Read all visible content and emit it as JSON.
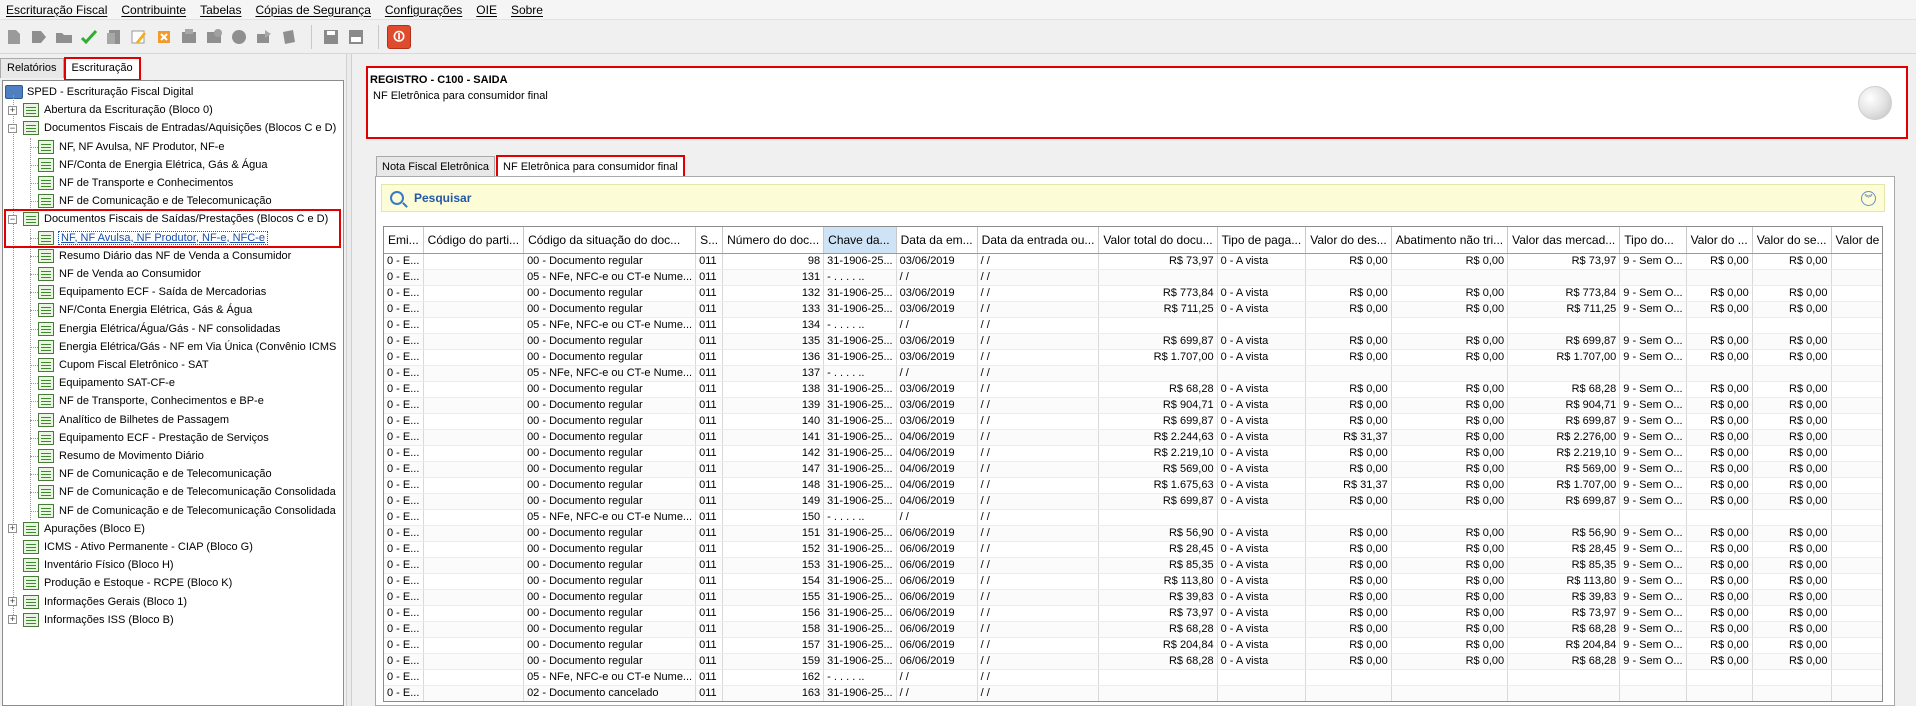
{
  "menu": [
    {
      "label": "Escrituração Fiscal"
    },
    {
      "label": "Contribuinte"
    },
    {
      "label": "Tabelas"
    },
    {
      "label": "Cópias de Segurança"
    },
    {
      "label": "Configurações"
    },
    {
      "label": "OIE"
    },
    {
      "label": "Sobre"
    }
  ],
  "toolbar": {
    "icons": [
      "new-record-icon",
      "forward-icon",
      "open-folder-icon",
      "validate-check-icon",
      "copy-icon",
      "edit-pen-icon",
      "delete-x-icon",
      "import-icon",
      "export-icon",
      "globe-icon",
      "send-icon",
      "print-icon",
      "save-icon",
      "report-icon",
      "stop-icon"
    ],
    "stop_glyph": "⏼"
  },
  "left_tabs": [
    {
      "label": "Relatórios"
    },
    {
      "label": "Escrituração"
    }
  ],
  "tree": {
    "root": "SPED - Escrituração Fiscal Digital",
    "items": [
      {
        "label": "Abertura da Escrituração (Bloco 0)",
        "level": 1,
        "expander": "+"
      },
      {
        "label": "Documentos Fiscais de Entradas/Aquisições (Blocos C e D)",
        "level": 1,
        "expander": "−"
      },
      {
        "label": "NF, NF Avulsa, NF Produtor, NF-e",
        "level": 2
      },
      {
        "label": "NF/Conta de Energia Elétrica, Gás & Água",
        "level": 2
      },
      {
        "label": "NF de Transporte e Conhecimentos",
        "level": 2
      },
      {
        "label": "NF de Comunicação e de Telecomunicação",
        "level": 2
      },
      {
        "label": "Documentos Fiscais de Saídas/Prestações (Blocos C e D)",
        "level": 1,
        "expander": "−"
      },
      {
        "label": "NF, NF Avulsa, NF Produtor, NF-e, NFC-e",
        "level": 2,
        "selected": true
      },
      {
        "label": "Resumo Diário das NF de Venda a Consumidor",
        "level": 2
      },
      {
        "label": "NF de Venda ao Consumidor",
        "level": 2
      },
      {
        "label": "Equipamento ECF - Saída de Mercadorias",
        "level": 2
      },
      {
        "label": "NF/Conta Energia Elétrica, Gás & Água",
        "level": 2
      },
      {
        "label": "Energia Elétrica/Água/Gás - NF consolidadas",
        "level": 2
      },
      {
        "label": "Energia Elétrica/Gás - NF em Via Única (Convênio ICMS",
        "level": 2
      },
      {
        "label": "Cupom Fiscal Eletrônico - SAT",
        "level": 2
      },
      {
        "label": "Equipamento SAT-CF-e",
        "level": 2
      },
      {
        "label": "NF de Transporte, Conhecimentos e BP-e",
        "level": 2
      },
      {
        "label": "Analítico de Bilhetes de Passagem",
        "level": 2
      },
      {
        "label": "Equipamento ECF - Prestação de Serviços",
        "level": 2
      },
      {
        "label": "Resumo de Movimento Diário",
        "level": 2
      },
      {
        "label": "NF de Comunicação e de Telecomunicação",
        "level": 2
      },
      {
        "label": "NF de Comunicação e de Telecomunicação Consolidada",
        "level": 2
      },
      {
        "label": "NF de Comunicação e de Telecomunicação Consolidada",
        "level": 2
      },
      {
        "label": "Apurações (Bloco E)",
        "level": 1,
        "expander": "+"
      },
      {
        "label": "ICMS - Ativo Permanente - CIAP (Bloco G)",
        "level": 1
      },
      {
        "label": "Inventário Físico (Bloco H)",
        "level": 1
      },
      {
        "label": "Produção e Estoque - RCPE (Bloco K)",
        "level": 1
      },
      {
        "label": "Informações Gerais (Bloco 1)",
        "level": 1,
        "expander": "+"
      },
      {
        "label": "Informações ISS (Bloco B)",
        "level": 1,
        "expander": "+"
      }
    ]
  },
  "header": {
    "title": "REGISTRO - C100 - SAIDA",
    "subtitle": "NF Eletrônica para consumidor final"
  },
  "content_tabs": [
    {
      "label": "Nota Fiscal Eletrônica"
    },
    {
      "label": "NF Eletrônica para consumidor final"
    }
  ],
  "search": {
    "label": "Pesquisar",
    "collapse_glyph": "︾"
  },
  "table": {
    "columns": [
      "Emi...",
      "Código do parti...",
      "Código da situação do doc...",
      "S...",
      "Número do doc...",
      "Chave da...",
      "Data da em...",
      "Data da entrada ou...",
      "Valor total do docu...",
      "Tipo de paga...",
      "Valor do des...",
      "Abatimento não tri...",
      "Valor das mercad...",
      "Tipo do...",
      "Valor do ...",
      "Valor do se...",
      "Valor de"
    ],
    "rows": [
      [
        "0 - E...",
        "",
        "00 - Documento regular",
        "011",
        "98",
        "31-1906-25...",
        "03/06/2019",
        " / /",
        "R$ 73,97",
        "0 - A vista",
        "R$ 0,00",
        "R$ 0,00",
        "R$ 73,97",
        "9 - Sem O...",
        "R$ 0,00",
        "R$ 0,00",
        ""
      ],
      [
        "0 - E...",
        "",
        "05 - NFe, NFC-e ou CT-e Nume...",
        "011",
        "131",
        " -  .  .  .  .  ..",
        " / /",
        " / /",
        "",
        "",
        "",
        "",
        "",
        "",
        "",
        "",
        ""
      ],
      [
        "0 - E...",
        "",
        "00 - Documento regular",
        "011",
        "132",
        "31-1906-25...",
        "03/06/2019",
        " / /",
        "R$ 773,84",
        "0 - A vista",
        "R$ 0,00",
        "R$ 0,00",
        "R$ 773,84",
        "9 - Sem O...",
        "R$ 0,00",
        "R$ 0,00",
        ""
      ],
      [
        "0 - E...",
        "",
        "00 - Documento regular",
        "011",
        "133",
        "31-1906-25...",
        "03/06/2019",
        " / /",
        "R$ 711,25",
        "0 - A vista",
        "R$ 0,00",
        "R$ 0,00",
        "R$ 711,25",
        "9 - Sem O...",
        "R$ 0,00",
        "R$ 0,00",
        ""
      ],
      [
        "0 - E...",
        "",
        "05 - NFe, NFC-e ou CT-e Nume...",
        "011",
        "134",
        " -  .  .  .  .  ..",
        " / /",
        " / /",
        "",
        "",
        "",
        "",
        "",
        "",
        "",
        "",
        ""
      ],
      [
        "0 - E...",
        "",
        "00 - Documento regular",
        "011",
        "135",
        "31-1906-25...",
        "03/06/2019",
        " / /",
        "R$ 699,87",
        "0 - A vista",
        "R$ 0,00",
        "R$ 0,00",
        "R$ 699,87",
        "9 - Sem O...",
        "R$ 0,00",
        "R$ 0,00",
        ""
      ],
      [
        "0 - E...",
        "",
        "00 - Documento regular",
        "011",
        "136",
        "31-1906-25...",
        "03/06/2019",
        " / /",
        "R$ 1.707,00",
        "0 - A vista",
        "R$ 0,00",
        "R$ 0,00",
        "R$ 1.707,00",
        "9 - Sem O...",
        "R$ 0,00",
        "R$ 0,00",
        ""
      ],
      [
        "0 - E...",
        "",
        "05 - NFe, NFC-e ou CT-e Nume...",
        "011",
        "137",
        " -  .  .  .  .  ..",
        " / /",
        " / /",
        "",
        "",
        "",
        "",
        "",
        "",
        "",
        "",
        ""
      ],
      [
        "0 - E...",
        "",
        "00 - Documento regular",
        "011",
        "138",
        "31-1906-25...",
        "03/06/2019",
        " / /",
        "R$ 68,28",
        "0 - A vista",
        "R$ 0,00",
        "R$ 0,00",
        "R$ 68,28",
        "9 - Sem O...",
        "R$ 0,00",
        "R$ 0,00",
        ""
      ],
      [
        "0 - E...",
        "",
        "00 - Documento regular",
        "011",
        "139",
        "31-1906-25...",
        "03/06/2019",
        " / /",
        "R$ 904,71",
        "0 - A vista",
        "R$ 0,00",
        "R$ 0,00",
        "R$ 904,71",
        "9 - Sem O...",
        "R$ 0,00",
        "R$ 0,00",
        ""
      ],
      [
        "0 - E...",
        "",
        "00 - Documento regular",
        "011",
        "140",
        "31-1906-25...",
        "03/06/2019",
        " / /",
        "R$ 699,87",
        "0 - A vista",
        "R$ 0,00",
        "R$ 0,00",
        "R$ 699,87",
        "9 - Sem O...",
        "R$ 0,00",
        "R$ 0,00",
        ""
      ],
      [
        "0 - E...",
        "",
        "00 - Documento regular",
        "011",
        "141",
        "31-1906-25...",
        "04/06/2019",
        " / /",
        "R$ 2.244,63",
        "0 - A vista",
        "R$ 31,37",
        "R$ 0,00",
        "R$ 2.276,00",
        "9 - Sem O...",
        "R$ 0,00",
        "R$ 0,00",
        ""
      ],
      [
        "0 - E...",
        "",
        "00 - Documento regular",
        "011",
        "142",
        "31-1906-25...",
        "04/06/2019",
        " / /",
        "R$ 2.219,10",
        "0 - A vista",
        "R$ 0,00",
        "R$ 0,00",
        "R$ 2.219,10",
        "9 - Sem O...",
        "R$ 0,00",
        "R$ 0,00",
        ""
      ],
      [
        "0 - E...",
        "",
        "00 - Documento regular",
        "011",
        "147",
        "31-1906-25...",
        "04/06/2019",
        " / /",
        "R$ 569,00",
        "0 - A vista",
        "R$ 0,00",
        "R$ 0,00",
        "R$ 569,00",
        "9 - Sem O...",
        "R$ 0,00",
        "R$ 0,00",
        ""
      ],
      [
        "0 - E...",
        "",
        "00 - Documento regular",
        "011",
        "148",
        "31-1906-25...",
        "04/06/2019",
        " / /",
        "R$ 1.675,63",
        "0 - A vista",
        "R$ 31,37",
        "R$ 0,00",
        "R$ 1.707,00",
        "9 - Sem O...",
        "R$ 0,00",
        "R$ 0,00",
        ""
      ],
      [
        "0 - E...",
        "",
        "00 - Documento regular",
        "011",
        "149",
        "31-1906-25...",
        "04/06/2019",
        " / /",
        "R$ 699,87",
        "0 - A vista",
        "R$ 0,00",
        "R$ 0,00",
        "R$ 699,87",
        "9 - Sem O...",
        "R$ 0,00",
        "R$ 0,00",
        ""
      ],
      [
        "0 - E...",
        "",
        "05 - NFe, NFC-e ou CT-e Nume...",
        "011",
        "150",
        " -  .  .  .  .  ..",
        " / /",
        " / /",
        "",
        "",
        "",
        "",
        "",
        "",
        "",
        "",
        ""
      ],
      [
        "0 - E...",
        "",
        "00 - Documento regular",
        "011",
        "151",
        "31-1906-25...",
        "06/06/2019",
        " / /",
        "R$ 56,90",
        "0 - A vista",
        "R$ 0,00",
        "R$ 0,00",
        "R$ 56,90",
        "9 - Sem O...",
        "R$ 0,00",
        "R$ 0,00",
        ""
      ],
      [
        "0 - E...",
        "",
        "00 - Documento regular",
        "011",
        "152",
        "31-1906-25...",
        "06/06/2019",
        " / /",
        "R$ 28,45",
        "0 - A vista",
        "R$ 0,00",
        "R$ 0,00",
        "R$ 28,45",
        "9 - Sem O...",
        "R$ 0,00",
        "R$ 0,00",
        ""
      ],
      [
        "0 - E...",
        "",
        "00 - Documento regular",
        "011",
        "153",
        "31-1906-25...",
        "06/06/2019",
        " / /",
        "R$ 85,35",
        "0 - A vista",
        "R$ 0,00",
        "R$ 0,00",
        "R$ 85,35",
        "9 - Sem O...",
        "R$ 0,00",
        "R$ 0,00",
        ""
      ],
      [
        "0 - E...",
        "",
        "00 - Documento regular",
        "011",
        "154",
        "31-1906-25...",
        "06/06/2019",
        " / /",
        "R$ 113,80",
        "0 - A vista",
        "R$ 0,00",
        "R$ 0,00",
        "R$ 113,80",
        "9 - Sem O...",
        "R$ 0,00",
        "R$ 0,00",
        ""
      ],
      [
        "0 - E...",
        "",
        "00 - Documento regular",
        "011",
        "155",
        "31-1906-25...",
        "06/06/2019",
        " / /",
        "R$ 39,83",
        "0 - A vista",
        "R$ 0,00",
        "R$ 0,00",
        "R$ 39,83",
        "9 - Sem O...",
        "R$ 0,00",
        "R$ 0,00",
        ""
      ],
      [
        "0 - E...",
        "",
        "00 - Documento regular",
        "011",
        "156",
        "31-1906-25...",
        "06/06/2019",
        " / /",
        "R$ 73,97",
        "0 - A vista",
        "R$ 0,00",
        "R$ 0,00",
        "R$ 73,97",
        "9 - Sem O...",
        "R$ 0,00",
        "R$ 0,00",
        ""
      ],
      [
        "0 - E...",
        "",
        "00 - Documento regular",
        "011",
        "158",
        "31-1906-25...",
        "06/06/2019",
        " / /",
        "R$ 68,28",
        "0 - A vista",
        "R$ 0,00",
        "R$ 0,00",
        "R$ 68,28",
        "9 - Sem O...",
        "R$ 0,00",
        "R$ 0,00",
        ""
      ],
      [
        "0 - E...",
        "",
        "00 - Documento regular",
        "011",
        "157",
        "31-1906-25...",
        "06/06/2019",
        " / /",
        "R$ 204,84",
        "0 - A vista",
        "R$ 0,00",
        "R$ 0,00",
        "R$ 204,84",
        "9 - Sem O...",
        "R$ 0,00",
        "R$ 0,00",
        ""
      ],
      [
        "0 - E...",
        "",
        "00 - Documento regular",
        "011",
        "159",
        "31-1906-25...",
        "06/06/2019",
        " / /",
        "R$ 68,28",
        "0 - A vista",
        "R$ 0,00",
        "R$ 0,00",
        "R$ 68,28",
        "9 - Sem O...",
        "R$ 0,00",
        "R$ 0,00",
        ""
      ],
      [
        "0 - E...",
        "",
        "05 - NFe, NFC-e ou CT-e Nume...",
        "011",
        "162",
        " -  .  .  .  .  ..",
        " / /",
        " / /",
        "",
        "",
        "",
        "",
        "",
        "",
        "",
        "",
        ""
      ],
      [
        "0 - E...",
        "",
        "02 - Documento cancelado",
        "011",
        "163",
        "31-1906-25...",
        " / /",
        " / /",
        "",
        "",
        "",
        "",
        "",
        "",
        "",
        "",
        ""
      ]
    ]
  }
}
